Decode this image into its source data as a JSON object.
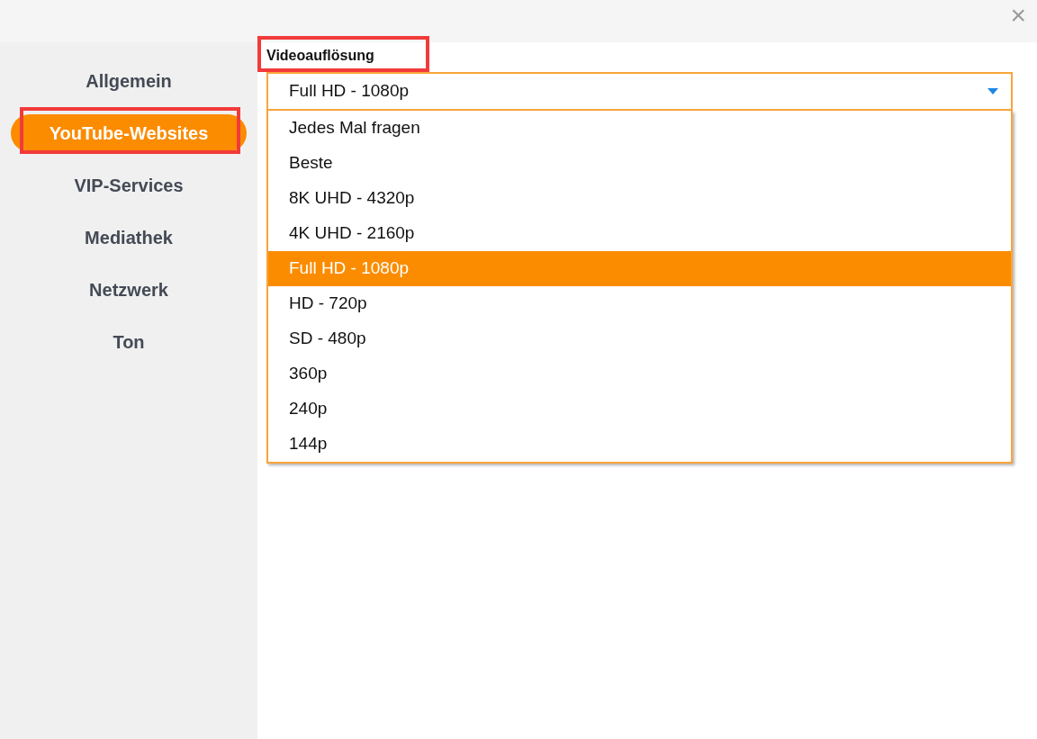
{
  "close": "×",
  "sidebar": {
    "items": [
      {
        "label": "Allgemein",
        "selected": false,
        "highlighted": false
      },
      {
        "label": "YouTube-Websites",
        "selected": true,
        "highlighted": true
      },
      {
        "label": "VIP-Services",
        "selected": false,
        "highlighted": false
      },
      {
        "label": "Mediathek",
        "selected": false,
        "highlighted": false
      },
      {
        "label": "Netzwerk",
        "selected": false,
        "highlighted": false
      },
      {
        "label": "Ton",
        "selected": false,
        "highlighted": false
      }
    ]
  },
  "setting": {
    "label": "Videoauflösung",
    "highlighted": true,
    "value": "Full HD - 1080p",
    "expanded": true,
    "options": [
      {
        "label": "Jedes Mal fragen",
        "selected": false
      },
      {
        "label": "Beste",
        "selected": false
      },
      {
        "label": "8K UHD - 4320p",
        "selected": false
      },
      {
        "label": "4K UHD - 2160p",
        "selected": false
      },
      {
        "label": "Full HD - 1080p",
        "selected": true
      },
      {
        "label": "HD - 720p",
        "selected": false
      },
      {
        "label": "SD - 480p",
        "selected": false
      },
      {
        "label": "360p",
        "selected": false
      },
      {
        "label": "240p",
        "selected": false
      },
      {
        "label": "144p",
        "selected": false
      }
    ]
  }
}
